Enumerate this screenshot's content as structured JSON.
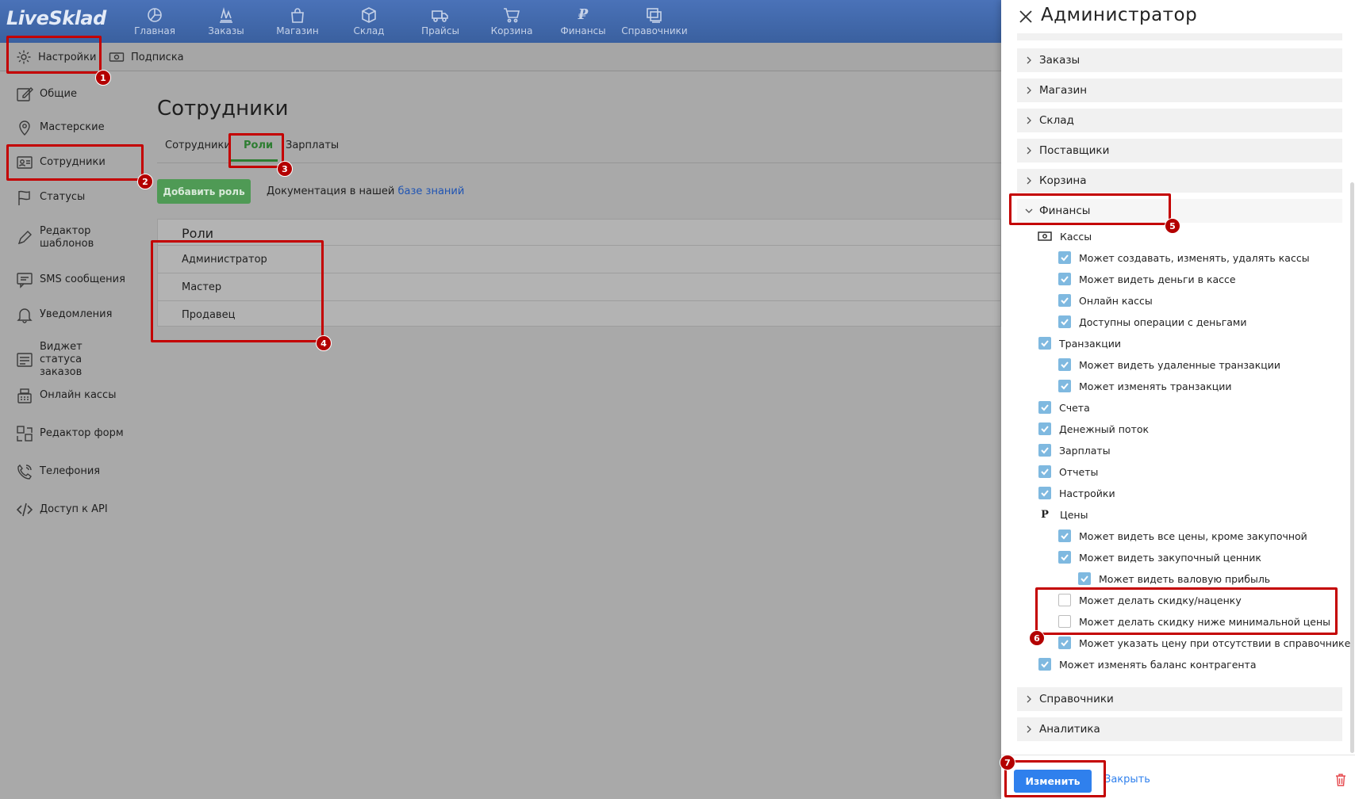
{
  "app": {
    "logo": "LiveSklad"
  },
  "topnav": [
    {
      "label": "Главная",
      "icon": "chart-pie-icon"
    },
    {
      "label": "Заказы",
      "icon": "orders-icon"
    },
    {
      "label": "Магазин",
      "icon": "shop-bag-icon"
    },
    {
      "label": "Склад",
      "icon": "box-icon"
    },
    {
      "label": "Прайсы",
      "icon": "truck-icon"
    },
    {
      "label": "Корзина",
      "icon": "cart-icon"
    },
    {
      "label": "Финансы",
      "icon": "ruble-icon",
      "glyph": "₽"
    },
    {
      "label": "Справочники",
      "icon": "directory-icon"
    }
  ],
  "subheader": {
    "settings": "Настройки",
    "subscription": "Подписка"
  },
  "sidebar": [
    {
      "label": "Общие",
      "icon": "edit-icon"
    },
    {
      "label": "Мастерские",
      "icon": "location-pin-icon"
    },
    {
      "label": "Сотрудники",
      "icon": "id-card-icon"
    },
    {
      "label": "Статусы",
      "icon": "flag-icon"
    },
    {
      "label": "Редактор шаблонов",
      "icon": "pen-icon"
    },
    {
      "label": "SMS сообщения",
      "icon": "message-icon"
    },
    {
      "label": "Уведомления",
      "icon": "bell-icon"
    },
    {
      "label": "Виджет статуса заказов",
      "icon": "widget-icon"
    },
    {
      "label": "Онлайн кассы",
      "icon": "cash-register-icon"
    },
    {
      "label": "Редактор форм",
      "icon": "form-editor-icon"
    },
    {
      "label": "Телефония",
      "icon": "phone-icon"
    },
    {
      "label": "Доступ к API",
      "icon": "code-icon"
    }
  ],
  "main": {
    "title": "Сотрудники",
    "tabs": [
      "Сотрудники",
      "Роли",
      "Зарплаты"
    ],
    "active_tab": "Роли",
    "add_role_button": "Добавить роль",
    "doc_text": "Документация в нашей",
    "doc_link": "базе знаний",
    "roles_title": "Роли",
    "roles": [
      "Администратор",
      "Мастер",
      "Продавец"
    ]
  },
  "drawer": {
    "title": "Администратор",
    "sections_top": [
      "Заказы",
      "Магазин",
      "Склад",
      "Поставщики",
      "Корзина"
    ],
    "open_section": "Финансы",
    "permissions": [
      {
        "label": "Кассы",
        "level": 0,
        "type": "icon",
        "icon": "cash-icon"
      },
      {
        "label": "Может создавать, изменять, удалять кассы",
        "level": 1,
        "checked": true
      },
      {
        "label": "Может видеть деньги в кассе",
        "level": 1,
        "checked": true
      },
      {
        "label": "Онлайн кассы",
        "level": 1,
        "checked": true
      },
      {
        "label": "Доступны операции с деньгами",
        "level": 1,
        "checked": true
      },
      {
        "label": "Транзакции",
        "level": 0,
        "checked": true
      },
      {
        "label": "Может видеть удаленные транзакции",
        "level": 1,
        "checked": true
      },
      {
        "label": "Может изменять транзакции",
        "level": 1,
        "checked": true
      },
      {
        "label": "Счета",
        "level": 0,
        "checked": true
      },
      {
        "label": "Денежный поток",
        "level": 0,
        "checked": true
      },
      {
        "label": "Зарплаты",
        "level": 0,
        "checked": true
      },
      {
        "label": "Отчеты",
        "level": 0,
        "checked": true
      },
      {
        "label": "Настройки",
        "level": 0,
        "checked": true
      },
      {
        "label": "Цены",
        "level": 0,
        "type": "icon",
        "icon": "ruble-icon",
        "glyph": "Р"
      },
      {
        "label": "Может видеть все цены, кроме закупочной",
        "level": 1,
        "checked": true
      },
      {
        "label": "Может видеть закупочный ценник",
        "level": 1,
        "checked": true
      },
      {
        "label": "Может видеть валовую прибыль",
        "level": 2,
        "checked": true
      },
      {
        "label": "Может делать скидку/наценку",
        "level": 1,
        "checked": false
      },
      {
        "label": "Может делать скидку ниже минимальной цены",
        "level": 1,
        "checked": false
      },
      {
        "label": "Может указать цену при отсутствии в справочнике",
        "level": 1,
        "checked": true
      },
      {
        "label": "Может изменять баланс контрагента",
        "level": 0,
        "checked": true
      }
    ],
    "sections_bottom": [
      "Справочники",
      "Аналитика"
    ],
    "save_button": "Изменить",
    "close_link": "Закрыть"
  },
  "annotations": [
    "1",
    "2",
    "3",
    "4",
    "5",
    "6",
    "7"
  ],
  "colors": {
    "highlight": "#c40000",
    "primary": "#2f80ed",
    "success": "#4f9a55",
    "checkbox": "#7fb9e0",
    "topbar": "#4a72b8"
  }
}
